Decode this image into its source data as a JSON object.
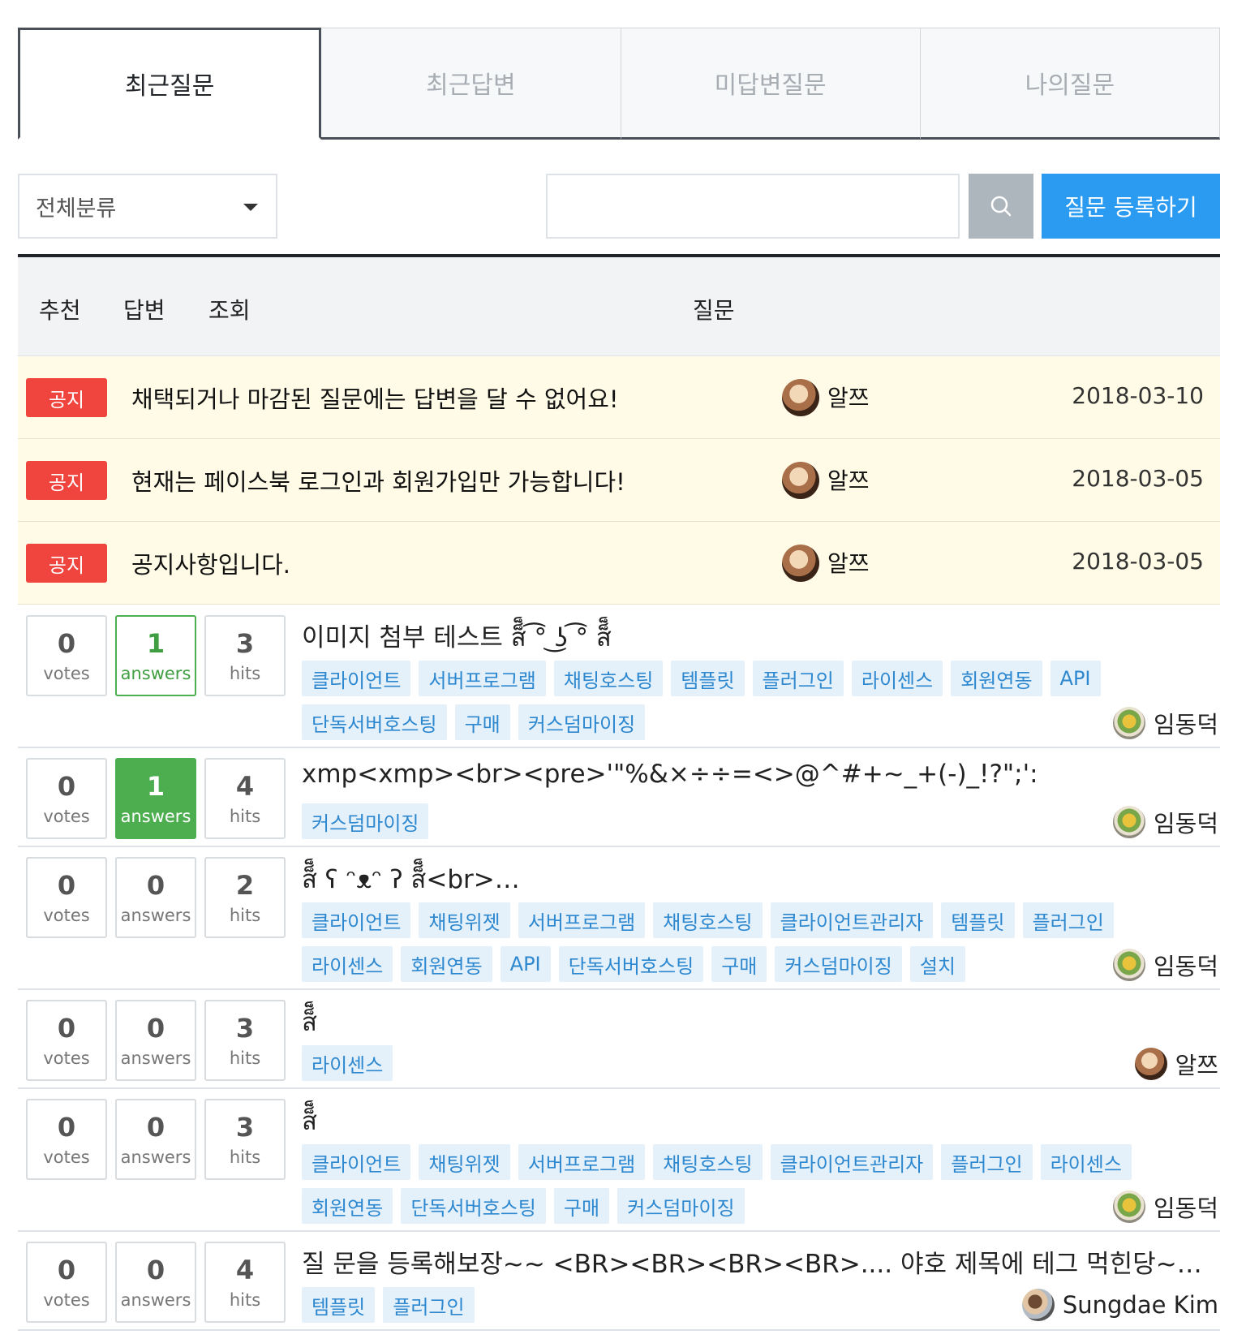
{
  "tabs": [
    {
      "label": "최근질문",
      "active": true
    },
    {
      "label": "최근답변",
      "active": false
    },
    {
      "label": "미답변질문",
      "active": false
    },
    {
      "label": "나의질문",
      "active": false
    }
  ],
  "toolbar": {
    "category_value": "전체분류",
    "search_placeholder": "",
    "ask_button": "질문 등록하기"
  },
  "table_header": {
    "votes": "추천",
    "answers": "답변",
    "hits": "조회",
    "question": "질문"
  },
  "notices": [
    {
      "badge": "공지",
      "title": "채택되거나 마감된 질문에는 답변을 달 수 없어요!",
      "author": "알쯔",
      "date": "2018-03-10"
    },
    {
      "badge": "공지",
      "title": "현재는 페이스북 로그인과 회원가입만 가능합니다!",
      "author": "알쯔",
      "date": "2018-03-05"
    },
    {
      "badge": "공지",
      "title": "공지사항입니다.",
      "author": "알쯔",
      "date": "2018-03-05"
    }
  ],
  "questions": [
    {
      "votes": "0",
      "votes_label": "votes",
      "answers": "1",
      "answers_label": "answers",
      "hits": "3",
      "hits_label": "hits",
      "answer_state": "answered",
      "title": "이미지 첨부 테스트 ส็็็็็็็็็็็็็็็็็็็็็็็็็็ ͡° ͜ʖ ͡° ส็็็็็็็็็็็็็็็็็็็็็็็็็็",
      "tags": [
        "클라이언트",
        "서버프로그램",
        "채팅호스팅",
        "템플릿",
        "플러그인",
        "라이센스",
        "회원연동",
        "API",
        "단독서버호스팅",
        "구매",
        "커스덤마이징"
      ],
      "author": "임동덕",
      "avatar_icon": "flower-avatar"
    },
    {
      "votes": "0",
      "votes_label": "votes",
      "answers": "1",
      "answers_label": "answers",
      "hits": "4",
      "hits_label": "hits",
      "answer_state": "accepted",
      "title": "xmp<xmp><br><pre>'\"%&×÷÷=<>@^#+~_+(-)_!?\";':",
      "tags": [
        "커스덤마이징"
      ],
      "author": "임동덕",
      "avatar_icon": "flower-avatar"
    },
    {
      "votes": "0",
      "votes_label": "votes",
      "answers": "0",
      "answers_label": "answers",
      "hits": "2",
      "hits_label": "hits",
      "answer_state": "none",
      "title": "ส็็็็็็็็็็็็็็็็็็็็็็็็็็็็็็็็็็ ʕ ᵔᴥᵔ ʔ ส็็็็็็็็็็็็็็็็็็็็็็็็็็็็็็็็<br>…",
      "tags": [
        "클라이언트",
        "채팅위젯",
        "서버프로그램",
        "채팅호스팅",
        "클라이언트관리자",
        "템플릿",
        "플러그인",
        "라이센스",
        "회원연동",
        "API",
        "단독서버호스팅",
        "구매",
        "커스덤마이징",
        "설치"
      ],
      "author": "임동덕",
      "avatar_icon": "flower-avatar"
    },
    {
      "votes": "0",
      "votes_label": "votes",
      "answers": "0",
      "answers_label": "answers",
      "hits": "3",
      "hits_label": "hits",
      "answer_state": "none",
      "title": "ส็็็็็็็็็็็็็็็็็็็็็็็็็็็็",
      "tags": [
        "라이센스"
      ],
      "author": "알쯔",
      "avatar_icon": "face-avatar"
    },
    {
      "votes": "0",
      "votes_label": "votes",
      "answers": "0",
      "answers_label": "answers",
      "hits": "3",
      "hits_label": "hits",
      "answer_state": "none",
      "title": "ส็็็็็็็็็็็็็็็็็็็็็็็็็็็็",
      "tags": [
        "클라이언트",
        "채팅위젯",
        "서버프로그램",
        "채팅호스팅",
        "클라이언트관리자",
        "플러그인",
        "라이센스",
        "회원연동",
        "단독서버호스팅",
        "구매",
        "커스덤마이징"
      ],
      "author": "임동덕",
      "avatar_icon": "flower-avatar"
    },
    {
      "votes": "0",
      "votes_label": "votes",
      "answers": "0",
      "answers_label": "answers",
      "hits": "4",
      "hits_label": "hits",
      "answer_state": "none",
      "title": "질 문을 등록해보장~~ <BR><BR><BR><BR>.... 야호 제목에 테그 먹힌당~…",
      "tags": [
        "템플릿",
        "플러그인"
      ],
      "author": "Sungdae Kim",
      "avatar_icon": "people-avatar"
    }
  ]
}
